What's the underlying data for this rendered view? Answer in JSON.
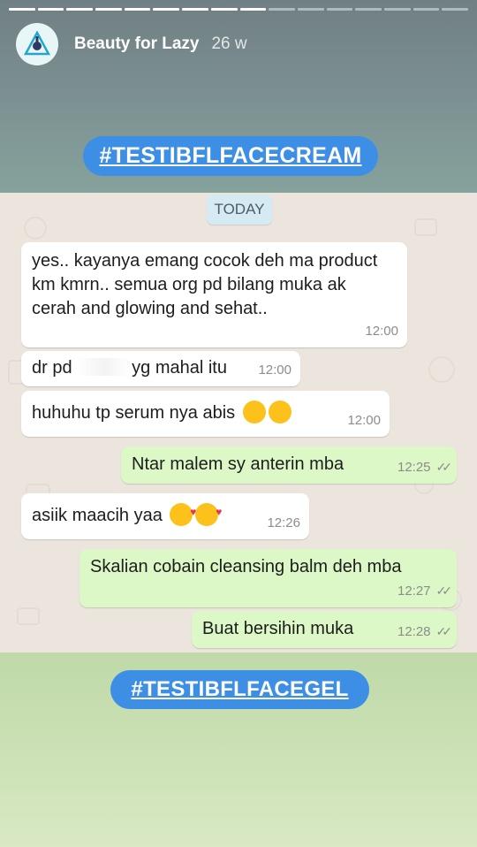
{
  "story": {
    "progress_total": 16,
    "progress_done": 9,
    "account_name": "Beauty for Lazy",
    "time_ago": "26 w",
    "hashtag_top": "#TESTIBFLFACECREAM",
    "hashtag_bottom": "#TESTIBFLFACEGEL"
  },
  "chat": {
    "date_label": "TODAY",
    "messages": [
      {
        "direction": "in",
        "text": "yes.. kayanya emang cocok deh ma product km kmrn.. semua org pd bilang muka ak cerah and glowing and sehat..",
        "time": "12:00"
      },
      {
        "direction": "in",
        "text_before": "dr pd",
        "text_after": "yg mahal itu",
        "time": "12:00"
      },
      {
        "direction": "in",
        "text": "huhuhu tp serum nya abis",
        "time": "12:00",
        "emojis": [
          "grinning-face-icon",
          "beaming-face-icon"
        ]
      },
      {
        "direction": "out",
        "text": "Ntar malem sy anterin mba",
        "time": "12:25"
      },
      {
        "direction": "in",
        "text": "asiik maacih yaa",
        "time": "12:26",
        "emojis": [
          "kissing-face-icon",
          "kissing-face-icon"
        ]
      },
      {
        "direction": "out",
        "text": "Skalian cobain cleansing balm deh mba",
        "time": "12:27"
      },
      {
        "direction": "out",
        "text": "Buat bersihin muka",
        "time": "12:28"
      }
    ]
  },
  "colors": {
    "hashtag_bg": "#3d8fe6",
    "incoming_bubble": "#ffffff",
    "outgoing_bubble": "#dcf8c6",
    "chat_bg": "#ece5dd"
  }
}
